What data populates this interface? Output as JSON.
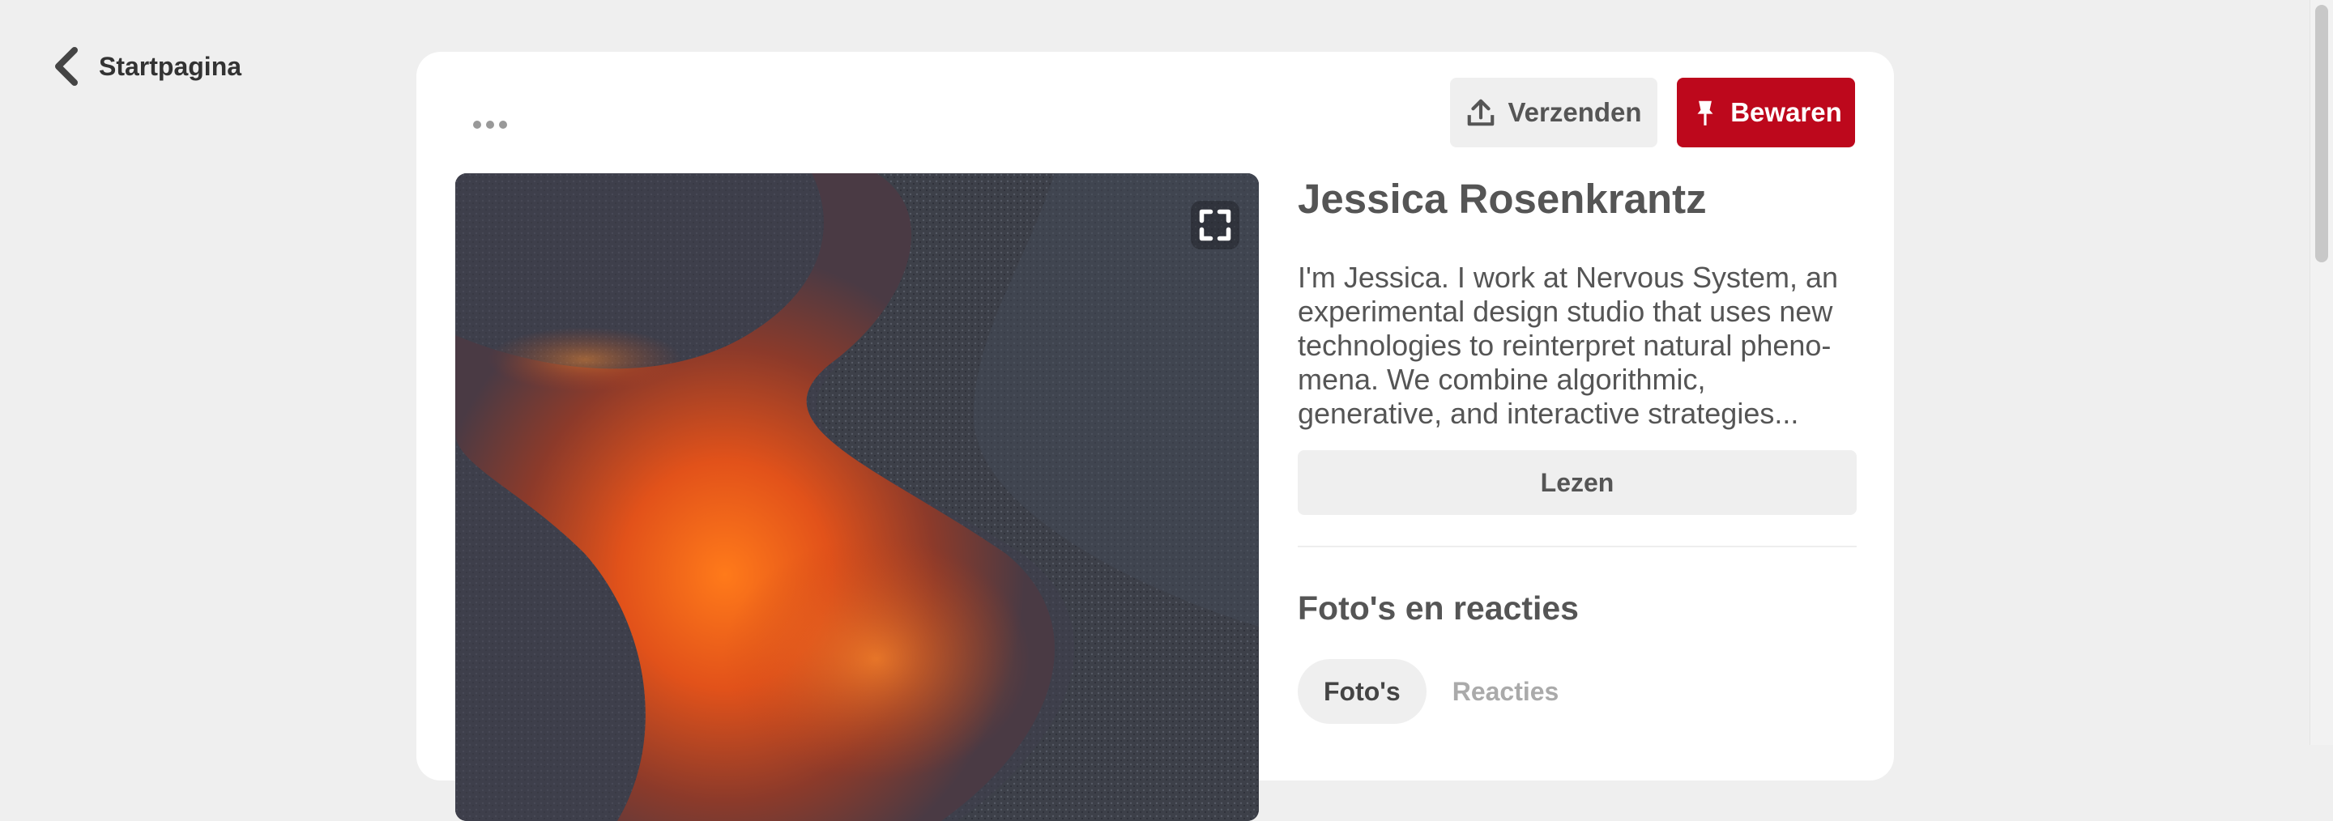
{
  "nav": {
    "back_label": "Startpagina"
  },
  "toolbar": {
    "send_label": "Verzenden",
    "save_label": "Bewaren"
  },
  "pin": {
    "author": "Jessica Rosenkrantz",
    "description": "I'm Jessica. I work at Nervous System, an experimental design studio that uses new technologies to reinterpret natural pheno-mena. We combine algorithmic, generative, and interactive strategies...",
    "read_label": "Lezen"
  },
  "section": {
    "title": "Foto's en reacties",
    "tabs": [
      {
        "label": "Foto's",
        "active": true
      },
      {
        "label": "Reacties",
        "active": false
      }
    ]
  },
  "icons": {
    "back": "chevron-left-icon",
    "more": "more-dots-icon",
    "send": "share-upload-icon",
    "save": "pin-icon",
    "expand": "expand-icon"
  },
  "colors": {
    "accent": "#bd081c",
    "background": "#efefef"
  }
}
